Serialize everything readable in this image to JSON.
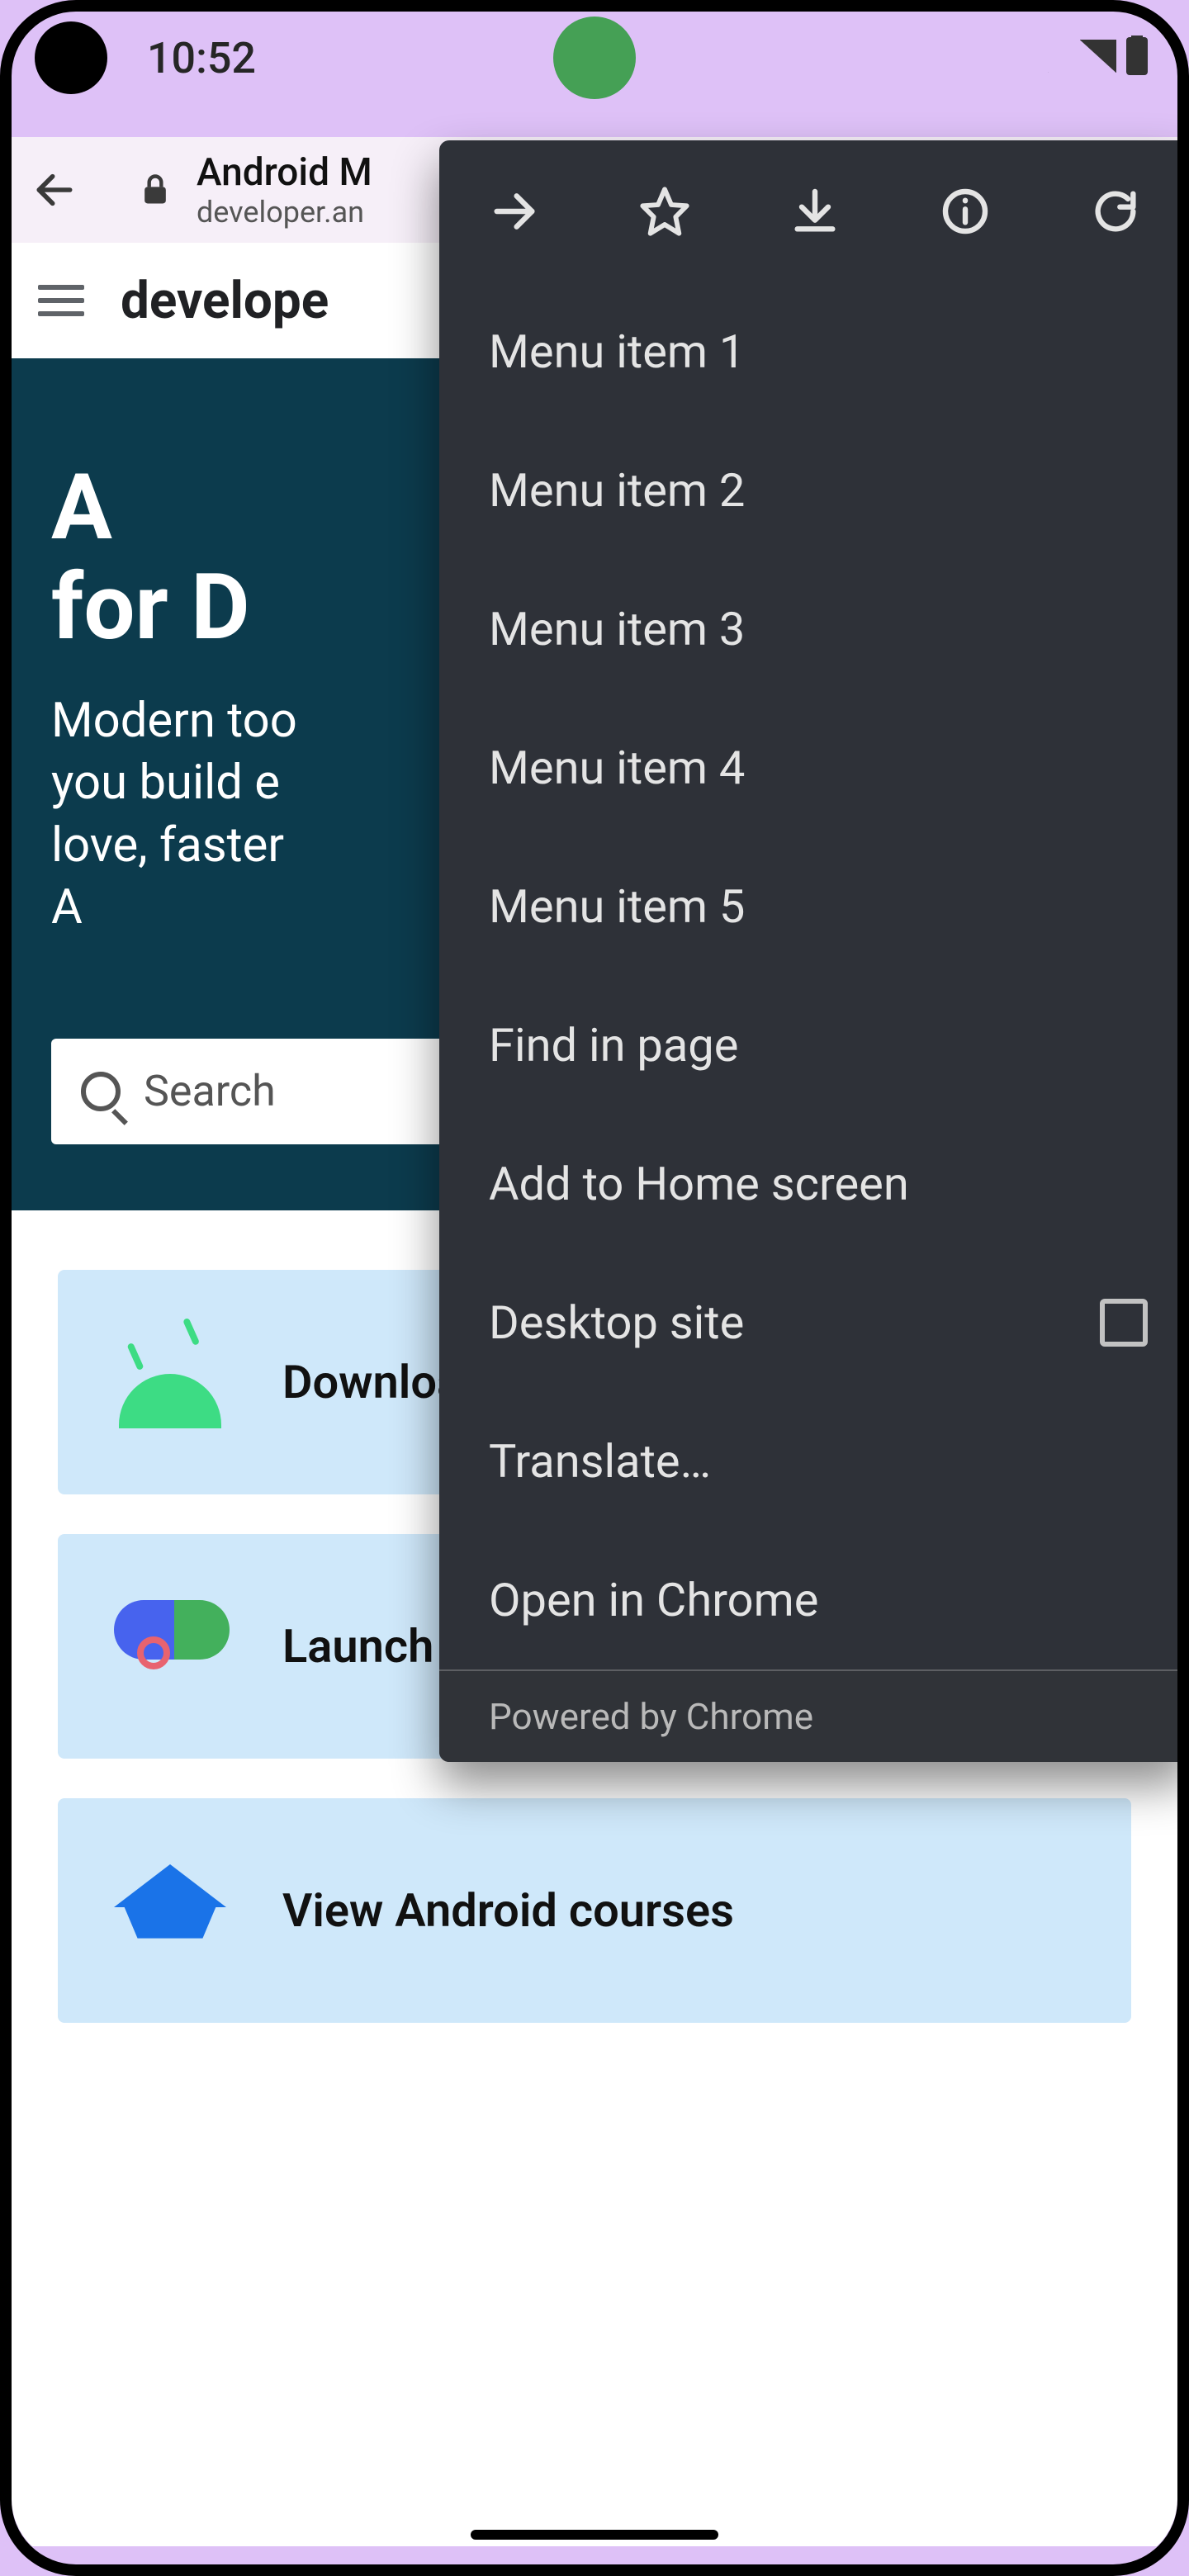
{
  "status": {
    "time": "10:52"
  },
  "toolbar": {
    "page_title": "Android M",
    "page_url": "developer.an"
  },
  "site": {
    "logo_text": "develope",
    "hero_title_line1": "A",
    "hero_title_line2": "for D",
    "hero_body_line1": "Modern too",
    "hero_body_line2": "you build e",
    "hero_body_line3": "love, faster",
    "hero_body_line4": "A",
    "search_placeholder": "Search"
  },
  "cards": [
    {
      "label": "Download Android Studio"
    },
    {
      "label": "Launch Play Console"
    },
    {
      "label": "View Android courses"
    }
  ],
  "menu": {
    "items": [
      "Menu item 1",
      "Menu item 2",
      "Menu item 3",
      "Menu item 4",
      "Menu item 5",
      "Find in page",
      "Add to Home screen"
    ],
    "desktop_label": "Desktop site",
    "translate_label": "Translate…",
    "open_label": "Open in Chrome",
    "powered_label": "Powered by Chrome"
  }
}
